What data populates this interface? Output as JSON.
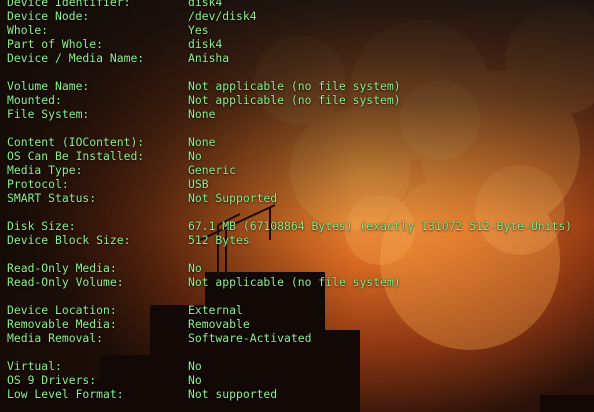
{
  "terminal": {
    "text_color": "#8ef08a",
    "background": "orange-red cloudy sky with dark city skyline silhouette and cranes",
    "rows": [
      {
        "label": "Device Identifier:",
        "value": "disk4"
      },
      {
        "label": "Device Node:",
        "value": "/dev/disk4"
      },
      {
        "label": "Whole:",
        "value": "Yes"
      },
      {
        "label": "Part of Whole:",
        "value": "disk4"
      },
      {
        "label": "Device / Media Name:",
        "value": "Anisha"
      },
      {
        "blank": true
      },
      {
        "label": "Volume Name:",
        "value": "Not applicable (no file system)"
      },
      {
        "label": "Mounted:",
        "value": "Not applicable (no file system)"
      },
      {
        "label": "File System:",
        "value": "None"
      },
      {
        "blank": true
      },
      {
        "label": "Content (IOContent):",
        "value": "None"
      },
      {
        "label": "OS Can Be Installed:",
        "value": "No"
      },
      {
        "label": "Media Type:",
        "value": "Generic"
      },
      {
        "label": "Protocol:",
        "value": "USB"
      },
      {
        "label": "SMART Status:",
        "value": "Not Supported"
      },
      {
        "blank": true
      },
      {
        "label": "Disk Size:",
        "value": "67.1 MB (67108864 Bytes) (exactly 131072 512-Byte-Units)"
      },
      {
        "label": "Device Block Size:",
        "value": "512 Bytes"
      },
      {
        "blank": true
      },
      {
        "label": "Read-Only Media:",
        "value": "No"
      },
      {
        "label": "Read-Only Volume:",
        "value": "Not applicable (no file system)"
      },
      {
        "blank": true
      },
      {
        "label": "Device Location:",
        "value": "External"
      },
      {
        "label": "Removable Media:",
        "value": "Removable"
      },
      {
        "label": "Media Removal:",
        "value": "Software-Activated"
      },
      {
        "blank": true
      },
      {
        "label": "Virtual:",
        "value": "No"
      },
      {
        "label": "OS 9 Drivers:",
        "value": "No"
      },
      {
        "label": "Low Level Format:",
        "value": "Not supported"
      }
    ]
  }
}
